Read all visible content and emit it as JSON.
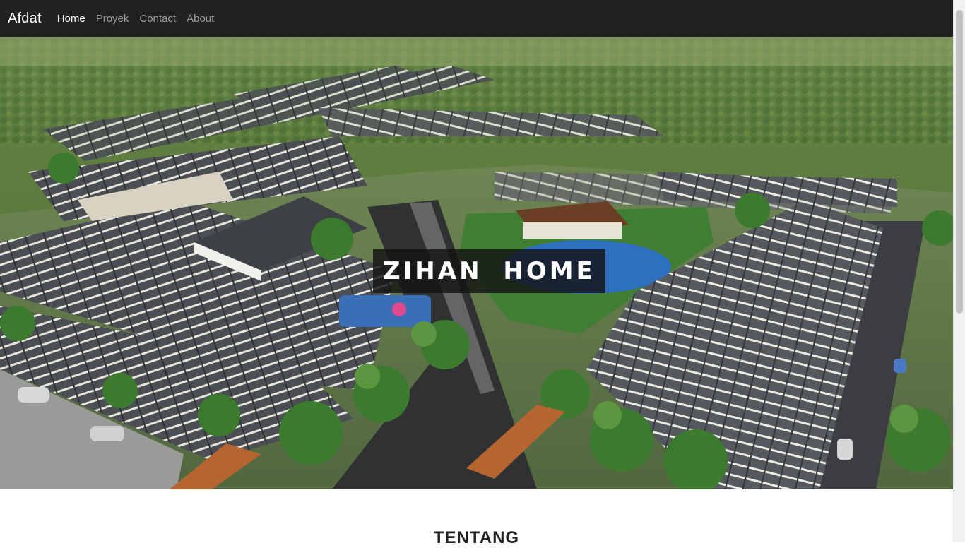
{
  "navbar": {
    "brand": "Afdat",
    "links": [
      {
        "label": "Home",
        "active": true
      },
      {
        "label": "Proyek",
        "active": false
      },
      {
        "label": "Contact",
        "active": false
      },
      {
        "label": "About",
        "active": false
      }
    ]
  },
  "hero": {
    "title": "ZIHAN HOME",
    "image_description": "aerial-housing-estate-render"
  },
  "about": {
    "heading": "TENTANG"
  },
  "colors": {
    "navbar_bg": "#212121",
    "nav_active": "#ffffff",
    "nav_inactive": "#9d9d9d"
  }
}
